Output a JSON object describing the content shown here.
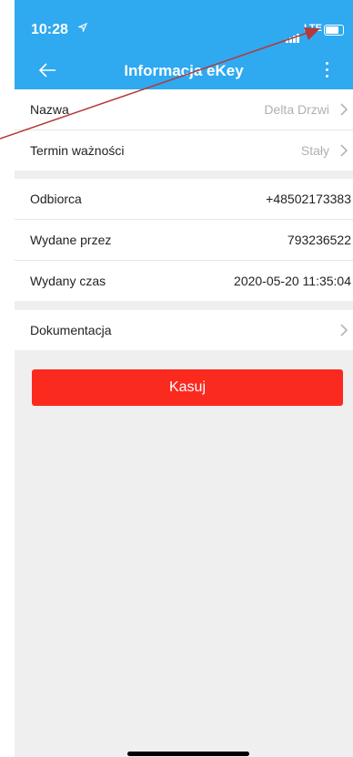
{
  "status": {
    "time": "10:28",
    "network": "LTE"
  },
  "nav": {
    "title": "Informacja eKey"
  },
  "details": [
    {
      "label": "Nazwa",
      "value": "Delta Drzwi"
    },
    {
      "label": "Termin ważności",
      "value": "Stały"
    }
  ],
  "info": [
    {
      "label": "Odbiorca",
      "value": "+48502173383"
    },
    {
      "label": "Wydane przez",
      "value": "793236522"
    },
    {
      "label": "Wydany czas",
      "value": "2020-05-20 11:35:04"
    }
  ],
  "docs": {
    "label": "Dokumentacja"
  },
  "actions": {
    "delete_label": "Kasuj"
  },
  "colors": {
    "accent": "#2fa9f0",
    "danger": "#fb2a1f",
    "annotation": "#b33a3a"
  }
}
